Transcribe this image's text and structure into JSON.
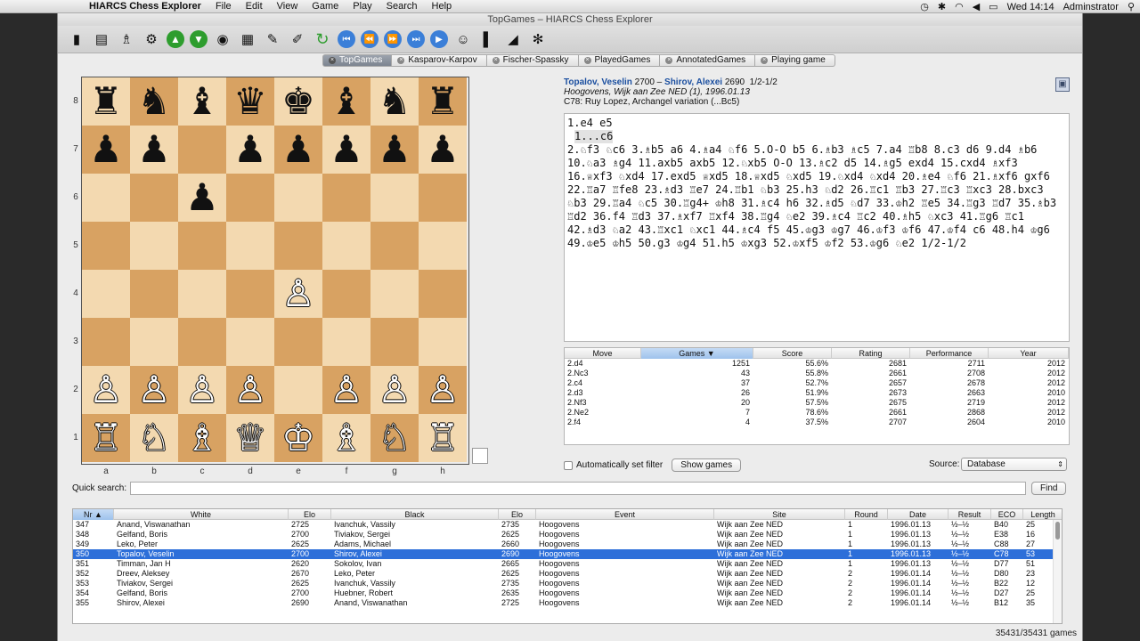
{
  "menubar": {
    "app": "HIARCS Chess Explorer",
    "items": [
      "File",
      "Edit",
      "View",
      "Game",
      "Play",
      "Search",
      "Help"
    ],
    "clock": "Wed 14:14",
    "user": "Adminstrator"
  },
  "window": {
    "title": "TopGames – HIARCS Chess Explorer"
  },
  "toolbar_icons": [
    "new-game-icon",
    "open-database-icon",
    "piece-setup-icon",
    "engine-icon",
    "previous-game-icon",
    "next-game-icon",
    "analysis-icon",
    "board-icon",
    "pencil-icon",
    "notes-icon",
    "refresh-icon",
    "first-move-icon",
    "back-move-icon",
    "forward-move-icon",
    "last-move-icon",
    "play-icon",
    "opponent-icon",
    "book-icon",
    "flip-board-icon",
    "spinner-icon"
  ],
  "tabs": [
    {
      "label": "TopGames",
      "active": true
    },
    {
      "label": "Kasparov-Karpov",
      "active": false
    },
    {
      "label": "Fischer-Spassky",
      "active": false
    },
    {
      "label": "PlayedGames",
      "active": false
    },
    {
      "label": "AnnotatedGames",
      "active": false
    },
    {
      "label": "Playing game",
      "active": false
    }
  ],
  "board": {
    "ranks": [
      "8",
      "7",
      "6",
      "5",
      "4",
      "3",
      "2",
      "1"
    ],
    "files": [
      "a",
      "b",
      "c",
      "d",
      "e",
      "f",
      "g",
      "h"
    ],
    "rows": [
      [
        "♜",
        "♞",
        "♝",
        "♛",
        "♚",
        "♝",
        "♞",
        "♜"
      ],
      [
        "♟",
        "♟",
        "",
        "♟",
        "♟",
        "♟",
        "♟",
        "♟"
      ],
      [
        "",
        "",
        "♟",
        "",
        "",
        "",
        "",
        ""
      ],
      [
        "",
        "",
        "",
        "",
        "",
        "",
        "",
        ""
      ],
      [
        "",
        "",
        "",
        "",
        "♙",
        "",
        "",
        ""
      ],
      [
        "",
        "",
        "",
        "",
        "",
        "",
        "",
        ""
      ],
      [
        "♙",
        "♙",
        "♙",
        "♙",
        "",
        "♙",
        "♙",
        "♙"
      ],
      [
        "♖",
        "♘",
        "♗",
        "♕",
        "♔",
        "♗",
        "♘",
        "♖"
      ]
    ]
  },
  "game": {
    "white": "Topalov, Veselin",
    "white_elo": "2700",
    "black": "Shirov, Alexei",
    "black_elo": "2690",
    "result": "1/2-1/2",
    "event": "Hoogovens, Wijk aan Zee NED (1), 1996.01.13",
    "opening": "C78: Ruy Lopez, Archangel variation (...Bc5)",
    "first_line": "1.e4 e5",
    "variation": "1...c6",
    "moves": "2.♘f3 ♘c6 3.♗b5 a6 4.♗a4 ♘f6 5.O-O b5 6.♗b3 ♗c5 7.a4 ♖b8 8.c3 d6 9.d4 ♗b6 10.♘a3 ♗g4 11.axb5 axb5 12.♘xb5 O-O 13.♗c2 d5 14.♗g5 exd4 15.cxd4 ♗xf3 16.♕xf3 ♘xd4 17.exd5 ♕xd5 18.♕xd5 ♘xd5 19.♘xd4 ♘xd4 20.♗e4 ♘f6 21.♗xf6 gxf6 22.♖a7 ♖fe8 23.♗d3 ♖e7 24.♖b1 ♘b3 25.h3 ♘d2 26.♖c1 ♖b3 27.♖c3 ♖xc3 28.bxc3 ♘b3 29.♖a4 ♘c5 30.♖g4+ ♔h8 31.♗c4 h6 32.♗d5 ♘d7 33.♔h2 ♖e5 34.♖g3 ♖d7 35.♗b3 ♖d2 36.f4 ♖d3 37.♗xf7 ♖xf4 38.♖g4 ♘e2 39.♗c4 ♖c2 40.♗h5 ♘xc3 41.♖g6 ♖c1 42.♗d3 ♘a2 43.♖xc1 ♘xc1 44.♗c4 f5 45.♔g3 ♔g7 46.♔f3 ♔f6 47.♔f4 c6 48.h4 ♔g6 49.♔e5 ♔h5 50.g3 ♔g4 51.h5 ♔xg3 52.♔xf5 ♔f2 53.♔g6 ♘e2 1/2-1/2"
  },
  "move_stats": {
    "headers": [
      "Move",
      "Games",
      "Score",
      "Rating",
      "Performance",
      "Year"
    ],
    "rows": [
      [
        "2.d4",
        "1251",
        "55.6%",
        "2681",
        "2711",
        "2012"
      ],
      [
        "2.Nc3",
        "43",
        "55.8%",
        "2661",
        "2708",
        "2012"
      ],
      [
        "2.c4",
        "37",
        "52.7%",
        "2657",
        "2678",
        "2012"
      ],
      [
        "2.d3",
        "26",
        "51.9%",
        "2673",
        "2663",
        "2010"
      ],
      [
        "2.Nf3",
        "20",
        "57.5%",
        "2675",
        "2719",
        "2012"
      ],
      [
        "2.Ne2",
        "7",
        "78.6%",
        "2661",
        "2868",
        "2012"
      ],
      [
        "2.f4",
        "4",
        "37.5%",
        "2707",
        "2604",
        "2010"
      ]
    ]
  },
  "filter": {
    "auto_label": "Automatically set filter",
    "show_games": "Show games",
    "source_label": "Source:",
    "source_value": "Database"
  },
  "quick_search": {
    "label": "Quick search:",
    "value": "",
    "find": "Find"
  },
  "games_table": {
    "headers": [
      "Nr",
      "White",
      "Elo",
      "Black",
      "Elo",
      "Event",
      "Site",
      "Round",
      "Date",
      "Result",
      "ECO",
      "Length"
    ],
    "selected_index": 3,
    "rows": [
      [
        "347",
        "Anand, Viswanathan",
        "2725",
        "Ivanchuk, Vassily",
        "2735",
        "Hoogovens",
        "Wijk aan Zee NED",
        "1",
        "1996.01.13",
        "½–½",
        "B40",
        "25"
      ],
      [
        "348",
        "Gelfand, Boris",
        "2700",
        "Tiviakov, Sergei",
        "2625",
        "Hoogovens",
        "Wijk aan Zee NED",
        "1",
        "1996.01.13",
        "½–½",
        "E38",
        "16"
      ],
      [
        "349",
        "Leko, Peter",
        "2625",
        "Adams, Michael",
        "2660",
        "Hoogovens",
        "Wijk aan Zee NED",
        "1",
        "1996.01.13",
        "½–½",
        "C88",
        "27"
      ],
      [
        "350",
        "Topalov, Veselin",
        "2700",
        "Shirov, Alexei",
        "2690",
        "Hoogovens",
        "Wijk aan Zee NED",
        "1",
        "1996.01.13",
        "½–½",
        "C78",
        "53"
      ],
      [
        "351",
        "Timman, Jan H",
        "2620",
        "Sokolov, Ivan",
        "2665",
        "Hoogovens",
        "Wijk aan Zee NED",
        "1",
        "1996.01.13",
        "½–½",
        "D77",
        "51"
      ],
      [
        "352",
        "Dreev, Aleksey",
        "2670",
        "Leko, Peter",
        "2625",
        "Hoogovens",
        "Wijk aan Zee NED",
        "2",
        "1996.01.14",
        "½–½",
        "D80",
        "23"
      ],
      [
        "353",
        "Tiviakov, Sergei",
        "2625",
        "Ivanchuk, Vassily",
        "2735",
        "Hoogovens",
        "Wijk aan Zee NED",
        "2",
        "1996.01.14",
        "½–½",
        "B22",
        "12"
      ],
      [
        "354",
        "Gelfand, Boris",
        "2700",
        "Huebner, Robert",
        "2635",
        "Hoogovens",
        "Wijk aan Zee NED",
        "2",
        "1996.01.14",
        "½–½",
        "D27",
        "25"
      ],
      [
        "355",
        "Shirov, Alexei",
        "2690",
        "Anand, Viswanathan",
        "2725",
        "Hoogovens",
        "Wijk aan Zee NED",
        "2",
        "1996.01.14",
        "½–½",
        "B12",
        "35"
      ]
    ]
  },
  "status": "35431/35431 games"
}
